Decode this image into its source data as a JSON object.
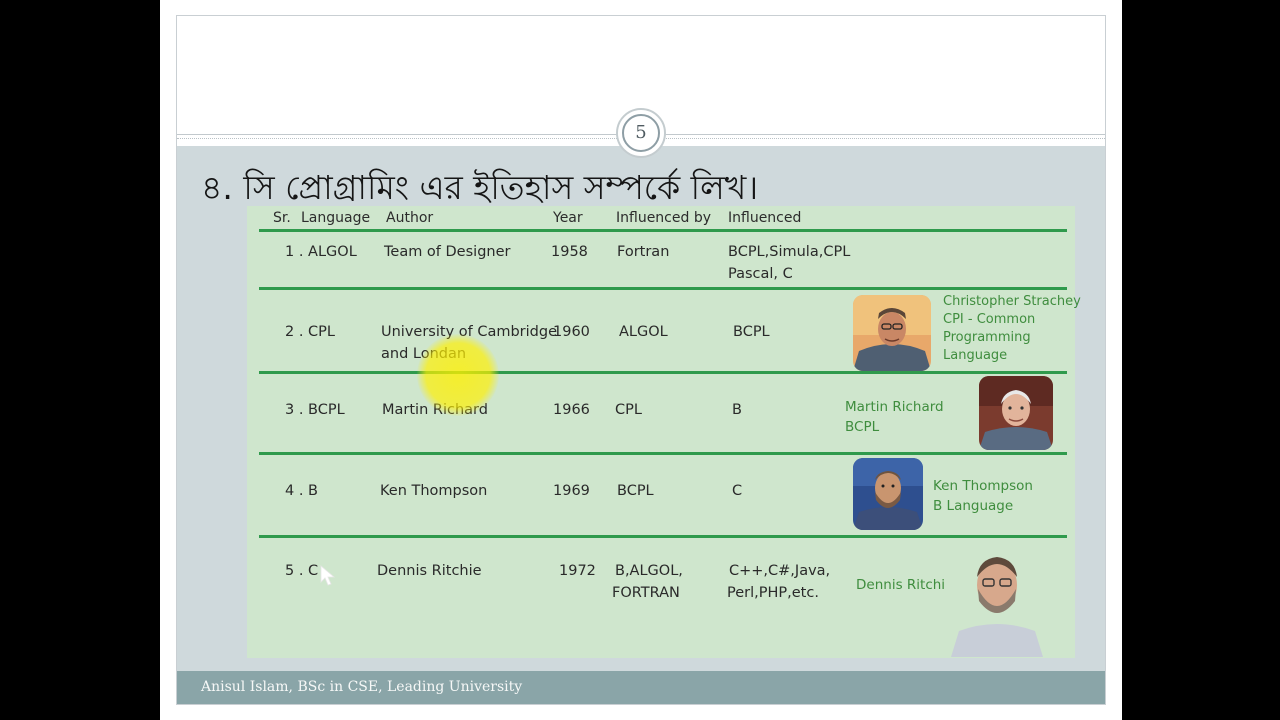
{
  "slide": {
    "page_number": "5",
    "title": "৪. সি প্রোগ্রামিং এর ইতিহাস সম্পর্কে লিখ।",
    "footer": "Anisul Islam, BSc in CSE, Leading University"
  },
  "table": {
    "headers": [
      "Sr.",
      "Language",
      "Author",
      "Year",
      "Influenced by",
      "Influenced"
    ],
    "rows": [
      {
        "sr": "1 . ALGOL",
        "author": [
          "Team of Designer"
        ],
        "year": "1958",
        "influenced_by": [
          "Fortran"
        ],
        "influenced": [
          "BCPL,Simula,CPL",
          "Pascal, C"
        ],
        "caption": []
      },
      {
        "sr": "2 . CPL",
        "author": [
          "University of Cambridge",
          "and Londan"
        ],
        "year": "1960",
        "influenced_by": [
          "ALGOL"
        ],
        "influenced": [
          "BCPL"
        ],
        "caption": [
          "Christopher Strachey",
          "CPI - Common",
          "Programming",
          "Language"
        ]
      },
      {
        "sr": "3 . BCPL",
        "author": [
          "Martin Richard"
        ],
        "year": "1966",
        "influenced_by": [
          "CPL"
        ],
        "influenced": [
          "B"
        ],
        "caption": [
          "Martin Richard",
          "BCPL"
        ]
      },
      {
        "sr": "4 . B",
        "author": [
          "Ken Thompson"
        ],
        "year": "1969",
        "influenced_by": [
          "BCPL"
        ],
        "influenced": [
          "C"
        ],
        "caption": [
          "Ken Thompson",
          "B Language"
        ]
      },
      {
        "sr": "5 . C",
        "author": [
          "Dennis Ritchie"
        ],
        "year": "1972",
        "influenced_by": [
          "B,ALGOL,",
          "FORTRAN"
        ],
        "influenced": [
          "C++,C#,Java,",
          "Perl,PHP,etc."
        ],
        "caption": [
          "Dennis Ritchie"
        ]
      }
    ]
  },
  "colors": {
    "accent_line": "#2f9a4c",
    "caption_text": "#3f8d3e",
    "table_bg": "#cfe6cd",
    "footer_bg": "#8aa5a8"
  }
}
